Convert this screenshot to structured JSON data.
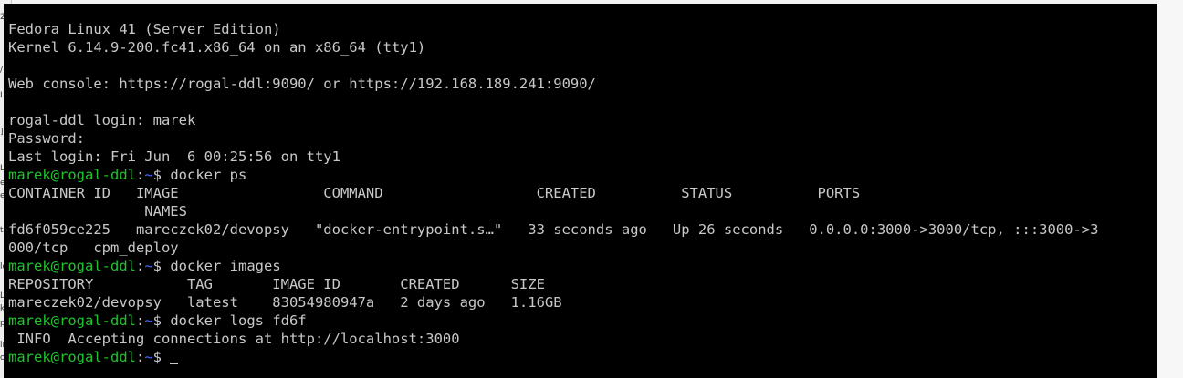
{
  "left_strip_glyphs": [
    "2",
    "/",
    "I",
    "]",
    "L",
    "er",
    "el",
    "t",
    "ld",
    "L",
    "ke",
    "p",
    "in",
    "om"
  ],
  "terminal": {
    "lines": [
      {
        "text": "Fedora Linux 41 (Server Edition)"
      },
      {
        "text": "Kernel 6.14.9-200.fc41.x86_64 on an x86_64 (tty1)"
      },
      {
        "text": ""
      },
      {
        "text": "Web console: https://rogal-ddl:9090/ or https://192.168.189.241:9090/"
      },
      {
        "text": ""
      },
      {
        "text": "rogal-ddl login: marek"
      },
      {
        "text": "Password:"
      },
      {
        "text": "Last login: Fri Jun  6 00:25:56 on tty1"
      },
      {
        "prompt": {
          "user": "marek@rogal-ddl",
          "colon": ":",
          "path": "~",
          "symbol": "$ "
        },
        "text": "docker ps"
      },
      {
        "text": "CONTAINER ID   IMAGE                 COMMAND                  CREATED          STATUS          PORTS"
      },
      {
        "text": "                NAMES"
      },
      {
        "text": "fd6f059ce225   mareczek02/devopsy   \"docker-entrypoint.s…\"   33 seconds ago   Up 26 seconds   0.0.0.0:3000->3000/tcp, :::3000->3"
      },
      {
        "text": "000/tcp   cpm_deploy"
      },
      {
        "prompt": {
          "user": "marek@rogal-ddl",
          "colon": ":",
          "path": "~",
          "symbol": "$ "
        },
        "text": "docker images"
      },
      {
        "text": "REPOSITORY           TAG       IMAGE ID       CREATED      SIZE"
      },
      {
        "text": "mareczek02/devopsy   latest    83054980947a   2 days ago   1.16GB"
      },
      {
        "prompt": {
          "user": "marek@rogal-ddl",
          "colon": ":",
          "path": "~",
          "symbol": "$ "
        },
        "text": "docker logs fd6f"
      },
      {
        "text": " INFO  Accepting connections at http://localhost:3000"
      },
      {
        "prompt": {
          "user": "marek@rogal-ddl",
          "colon": ":",
          "path": "~",
          "symbol": "$ "
        },
        "text": "",
        "cursor": true
      }
    ]
  },
  "colors": {
    "background": "#000000",
    "foreground": "#c8c8c8",
    "prompt_user": "#22c22e",
    "prompt_path": "#4b68ff"
  }
}
